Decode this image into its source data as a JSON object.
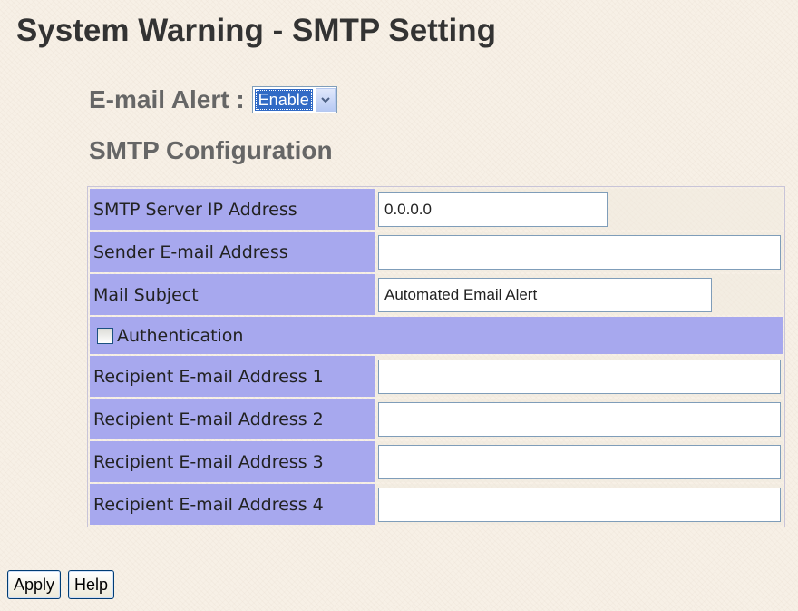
{
  "page": {
    "title": "System Warning - SMTP Setting"
  },
  "email_alert": {
    "label": "E-mail Alert :",
    "selected": "Enable"
  },
  "smtp": {
    "section_title": "SMTP Configuration",
    "server_ip": {
      "label": "SMTP Server IP Address",
      "value": "0.0.0.0"
    },
    "sender": {
      "label": "Sender E-mail Address",
      "value": ""
    },
    "subject": {
      "label": "Mail Subject",
      "value": "Automated Email Alert"
    },
    "authentication": {
      "label": "Authentication",
      "checked": false
    },
    "recipients": [
      {
        "label": "Recipient E-mail Address 1",
        "value": ""
      },
      {
        "label": "Recipient E-mail Address 2",
        "value": ""
      },
      {
        "label": "Recipient E-mail Address 3",
        "value": ""
      },
      {
        "label": "Recipient E-mail Address 4",
        "value": ""
      }
    ]
  },
  "buttons": {
    "apply": "Apply",
    "help": "Help"
  },
  "colors": {
    "label_cell": "#a7a8ee",
    "select_highlight": "#316ac5",
    "background": "#f7f0e6"
  }
}
